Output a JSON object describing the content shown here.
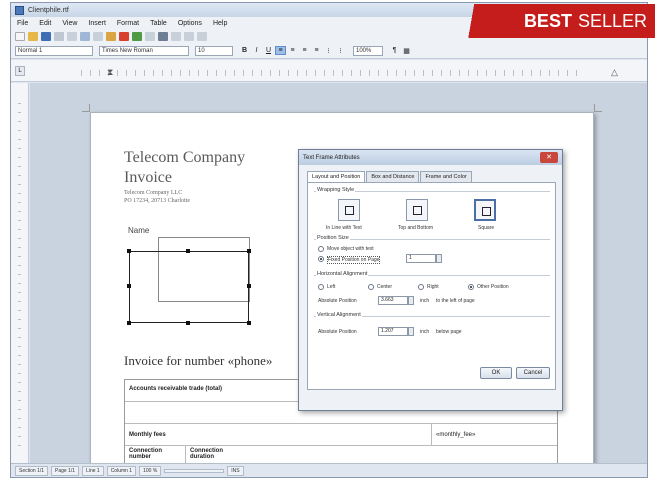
{
  "window": {
    "title": "Clientphile.rtf"
  },
  "menu": [
    "File",
    "Edit",
    "View",
    "Insert",
    "Format",
    "Table",
    "Options",
    "Help"
  ],
  "format_bar": {
    "style": "Normal 1",
    "font": "Times New Roman",
    "size": "10",
    "zoom": "100%"
  },
  "document": {
    "company": "Telecom Company",
    "invoice_title": "Invoice",
    "address_line1": "Telecom Company LLC",
    "address_line2": "PO 17234, 20713 Charlotte",
    "name_label": "Name",
    "invoice_number": "Invoice for number «phone»",
    "table": {
      "row1_left": "Accounts receivable trade (total)",
      "row2_left": "Monthly fees",
      "row2_right": "«monthly_fee»",
      "row3_col1": "Connection number",
      "row3_col2": "Connection duration"
    }
  },
  "dialog": {
    "title": "Text Frame Attributes",
    "close": "✕",
    "tabs": [
      "Layout and Position",
      "Box and Distance",
      "Frame and Color"
    ],
    "wrapping_title": "Wrapping Style",
    "wrap_options": [
      "In Line with Text",
      "Top and Bottom",
      "Square"
    ],
    "position_size_title": "Position Size",
    "position_opt1": "Move object with text",
    "position_opt2": "Fixed Position on Page",
    "position_value": "1",
    "horizontal_title": "Horizontal Alignment",
    "h_opts": [
      "Left",
      "Center",
      "Right",
      "Other Position"
    ],
    "abs_pos_label": "Absolute Position",
    "h_value": "3.663",
    "h_unit": "inch",
    "h_suffix": "to the left of page",
    "vertical_title": "Vertical Alignment",
    "v_value": "1.207",
    "v_unit": "inch",
    "v_suffix": "below page",
    "ok": "OK",
    "cancel": "Cancel"
  },
  "status": [
    "Section 1/1",
    "Page 1/1",
    "Line 1",
    "Column 1",
    "100 %",
    "",
    "INS"
  ],
  "badge": {
    "bold": "BEST",
    "normal": "SELLER"
  }
}
